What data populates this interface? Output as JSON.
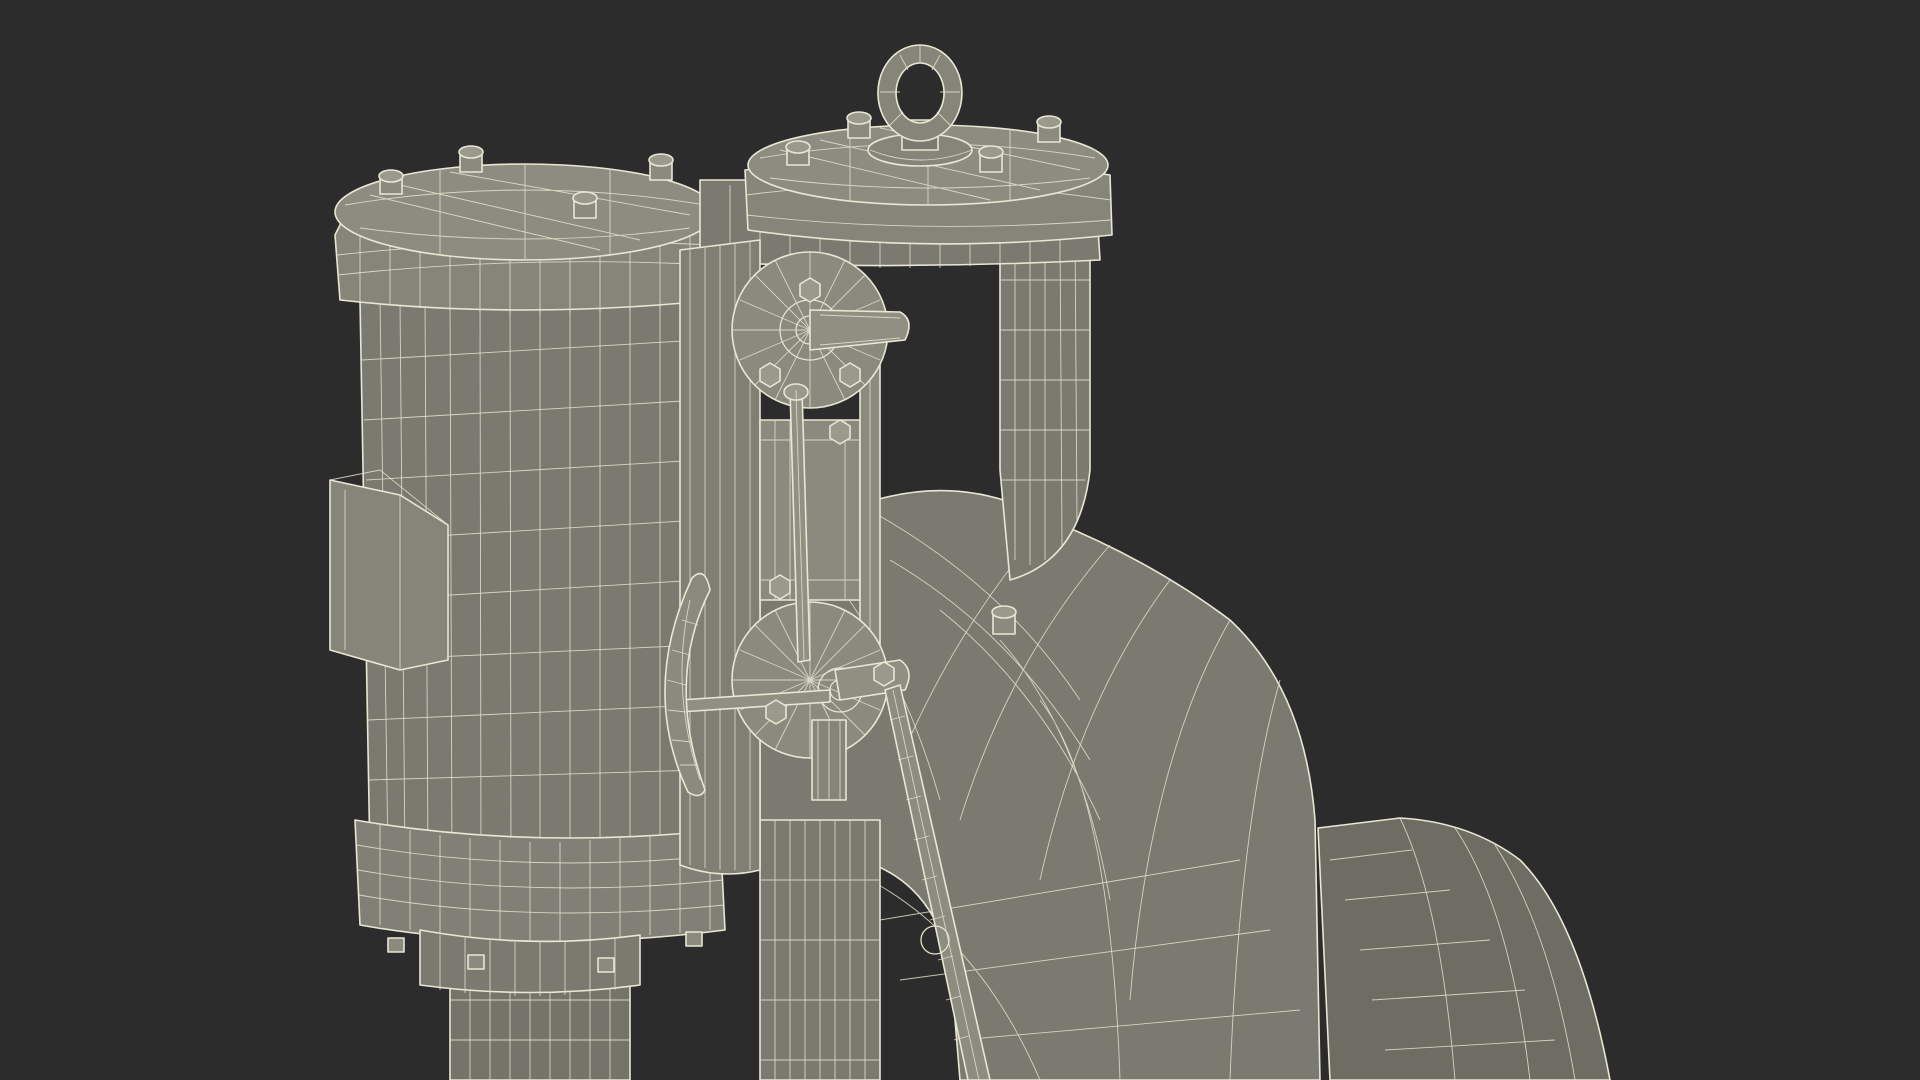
{
  "scene": {
    "background_color": "#2c2c2c",
    "model_fill_color": "#7a7a70",
    "model_shade_color": "#6d6d64",
    "wire_color": "#e6e3cf"
  }
}
